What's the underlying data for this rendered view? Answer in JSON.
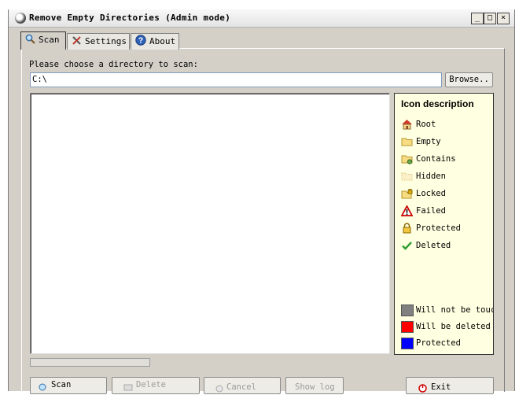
{
  "window": {
    "title": "Remove Empty Directories (Admin mode)",
    "minimize": "_",
    "maximize": "□",
    "close": "×"
  },
  "tabs": [
    {
      "label": "Scan",
      "icon": "magnifier-icon"
    },
    {
      "label": "Settings",
      "icon": "tools-icon"
    },
    {
      "label": "About",
      "icon": "help-icon"
    }
  ],
  "scan": {
    "prompt": "Please choose a directory to scan:",
    "directory": "C:\\",
    "browse_label": "Browse.."
  },
  "legend": {
    "title": "Icon description",
    "items": [
      {
        "label": "Root",
        "icon": "house-icon"
      },
      {
        "label": "Empty",
        "icon": "folder-icon"
      },
      {
        "label": "Contains",
        "icon": "folder-contains-icon"
      },
      {
        "label": "Hidden",
        "icon": "hidden-folder-icon"
      },
      {
        "label": "Locked",
        "icon": "locked-folder-icon"
      },
      {
        "label": "Failed",
        "icon": "warning-icon"
      },
      {
        "label": "Protected",
        "icon": "lock-icon"
      },
      {
        "label": "Deleted",
        "icon": "checkmark-icon"
      }
    ],
    "colors": [
      {
        "label": "Will not be touched",
        "color": "#808080"
      },
      {
        "label": "Will be deleted",
        "color": "#ff0000"
      },
      {
        "label": "Protected",
        "color": "#0000ff"
      }
    ]
  },
  "progress": {
    "value": 0
  },
  "buttons": {
    "scan": "Scan",
    "delete": "Delete",
    "cancel": "Cancel",
    "show_log": "Show log",
    "exit": "Exit"
  }
}
